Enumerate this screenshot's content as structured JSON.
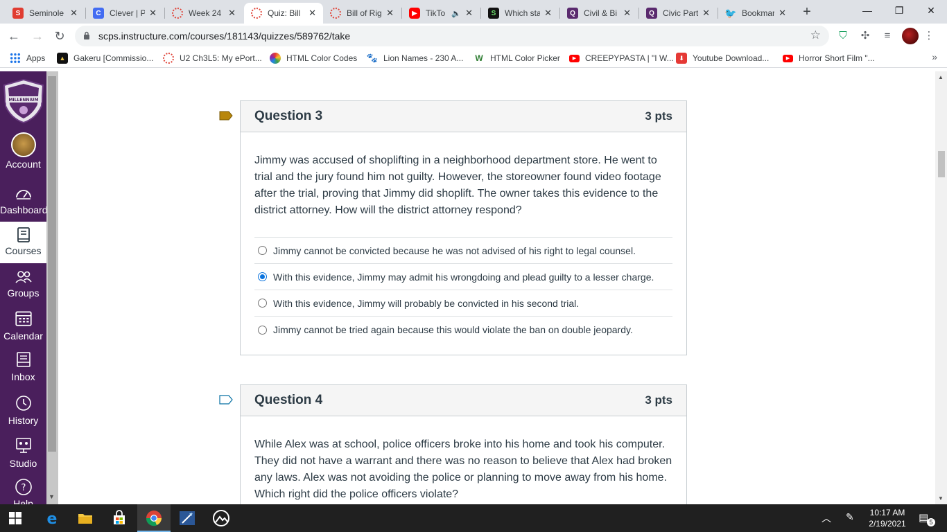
{
  "browser": {
    "tabs": [
      {
        "title": "Seminole",
        "fav_color": "#e03c31",
        "fav_letter": "S"
      },
      {
        "title": "Clever | P",
        "fav_color": "#436cf2",
        "fav_letter": "C"
      },
      {
        "title": "Week 24",
        "fav_color": "#e0453a",
        "fav_letter": ""
      },
      {
        "title": "Quiz: Bill",
        "fav_color": "#e0453a",
        "fav_letter": ""
      },
      {
        "title": "Bill of Rig",
        "fav_color": "#e0453a",
        "fav_letter": ""
      },
      {
        "title": "TikTo",
        "fav_color": "#ff0000",
        "fav_letter": ""
      },
      {
        "title": "Which sta",
        "fav_color": "#111111",
        "fav_letter": "S"
      },
      {
        "title": "Civil & Bi",
        "fav_color": "#5a2a6e",
        "fav_letter": "Q"
      },
      {
        "title": "Civic Part",
        "fav_color": "#5a2a6e",
        "fav_letter": "Q"
      },
      {
        "title": "Bookmar",
        "fav_color": "#1d9bf0",
        "fav_letter": ""
      }
    ],
    "active_tab_index": 3,
    "url": "scps.instructure.com/courses/181143/quizzes/589762/take",
    "bookmarks": [
      {
        "label": "Apps",
        "fav_color": "#1a73e8"
      },
      {
        "label": "Gakeru [Commissio...",
        "fav_color": "#222222"
      },
      {
        "label": "U2 Ch3L5: My ePort...",
        "fav_color": "#e0453a"
      },
      {
        "label": "HTML Color Codes",
        "fav_color": "#4caf50"
      },
      {
        "label": "Lion Names - 230 A...",
        "fav_color": "#d32f2f"
      },
      {
        "label": "HTML Color Picker",
        "fav_color": "#2e7d32"
      },
      {
        "label": "CREEPYPASTA | \"I W...",
        "fav_color": "#ff0000"
      },
      {
        "label": "Youtube Download...",
        "fav_color": "#e53935"
      },
      {
        "label": "Horror Short Film \"...",
        "fav_color": "#ff0000"
      }
    ]
  },
  "canvas_nav": {
    "items": [
      {
        "label": "Account"
      },
      {
        "label": "Dashboard"
      },
      {
        "label": "Courses"
      },
      {
        "label": "Groups"
      },
      {
        "label": "Calendar"
      },
      {
        "label": "Inbox"
      },
      {
        "label": "History"
      },
      {
        "label": "Studio"
      },
      {
        "label": "Help"
      }
    ],
    "active_index": 2,
    "logo_text": "MILLENNIUM"
  },
  "questions": [
    {
      "name": "Question 3",
      "points": "3 pts",
      "flagged": true,
      "text": "Jimmy was accused of shoplifting in a neighborhood department store. He went to trial and the jury found him not guilty. However, the storeowner found video footage after the trial, proving that Jimmy did shoplift. The owner takes this evidence to the district attorney. How will the district attorney respond?",
      "answers": [
        {
          "text": "Jimmy cannot be convicted because he was not advised of his right to legal counsel.",
          "selected": false
        },
        {
          "text": "With this evidence, Jimmy may admit his wrongdoing and plead guilty to a lesser charge.",
          "selected": true
        },
        {
          "text": "With this evidence, Jimmy will probably be convicted in his second trial.",
          "selected": false
        },
        {
          "text": "Jimmy cannot be tried again because this would violate the ban on double jeopardy.",
          "selected": false
        }
      ]
    },
    {
      "name": "Question 4",
      "points": "3 pts",
      "flagged": false,
      "text": "While Alex was at school, police officers broke into his home and took his computer. They did not have a warrant and there was no reason to believe that Alex had broken any laws. Alex was not avoiding the police or planning to move away from his home. Which right did the police officers violate?",
      "answers": []
    }
  ],
  "taskbar": {
    "time": "10:17 AM",
    "date": "2/19/2021",
    "notifications": "5"
  }
}
